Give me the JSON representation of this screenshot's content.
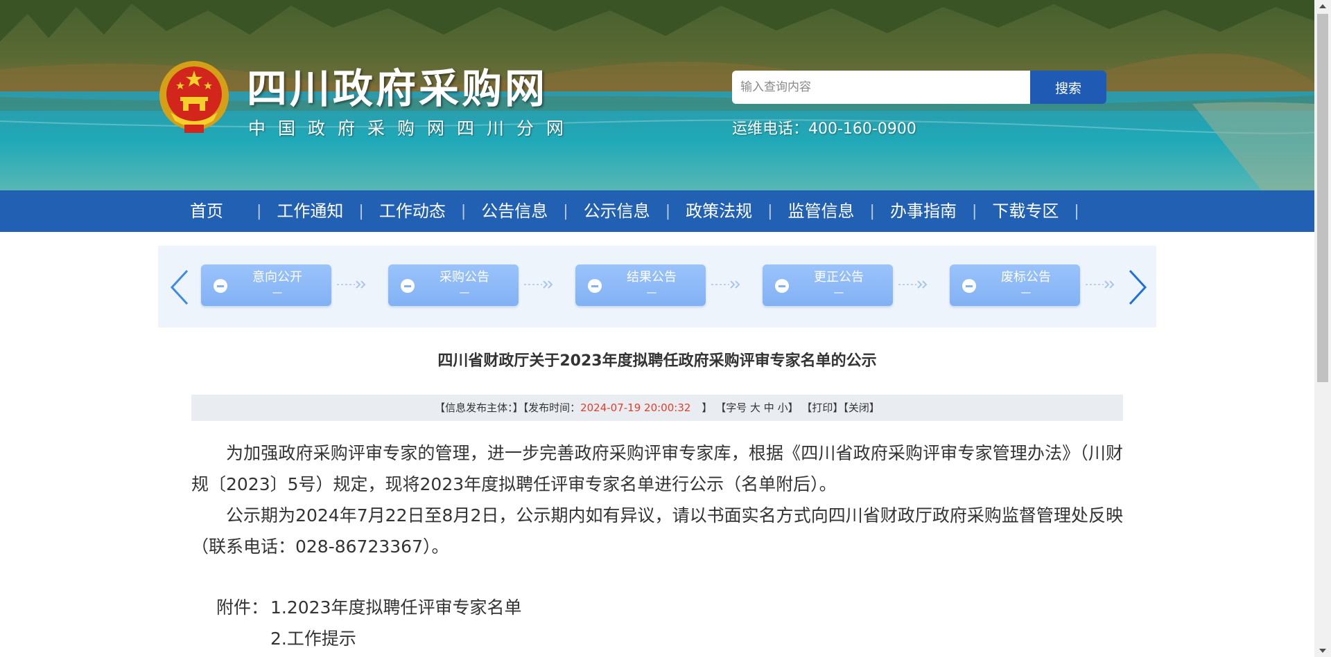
{
  "header": {
    "site_title": "四川政府采购网",
    "site_subtitle": "中国政府采购网四川分网",
    "search_placeholder": "输入查询内容",
    "search_button": "搜索",
    "hotline": "运维电话：400-160-0900"
  },
  "nav": {
    "items": [
      {
        "label": "首页"
      },
      {
        "label": "工作通知"
      },
      {
        "label": "工作动态"
      },
      {
        "label": "公告信息"
      },
      {
        "label": "公示信息"
      },
      {
        "label": "政策法规"
      },
      {
        "label": "监管信息"
      },
      {
        "label": "办事指南"
      },
      {
        "label": "下载专区"
      }
    ],
    "separator": "|"
  },
  "process": {
    "prev_icon": "chevron-left-icon",
    "next_icon": "chevron-right-icon",
    "steps": [
      {
        "label": "意向公开",
        "count": "—"
      },
      {
        "label": "采购公告",
        "count": "—"
      },
      {
        "label": "结果公告",
        "count": "—"
      },
      {
        "label": "更正公告",
        "count": "—"
      },
      {
        "label": "废标公告",
        "count": "—"
      }
    ]
  },
  "article": {
    "title": "四川省财政厅关于2023年度拟聘任政府采购评审专家名单的公示",
    "meta": {
      "publisher": "【信息发布主体：】",
      "time_label": "【发布时间：",
      "time_value": "2024-07-19 20:00:32",
      "time_close": "】",
      "font_label": "【字号",
      "font_large": "大",
      "font_medium": "中",
      "font_small": "小",
      "font_close": "】",
      "print": "【打印】",
      "close": "【关闭】"
    },
    "paragraphs": [
      "为加强政府采购评审专家的管理，进一步完善政府采购评审专家库，根据《四川省政府采购评审专家管理办法》（川财规〔2023〕5号）规定，现将2023年度拟聘任评审专家名单进行公示（名单附后）。",
      "公示期为2024年7月22日至8月2日，公示期内如有异议，请以书面实名方式向四川省财政厅政府采购监督管理处反映（联系电话：028-86723367）。"
    ],
    "attachment_label": "附件：",
    "attachments": [
      "1.2023年度拟聘任评审专家名单",
      "2.工作提示"
    ]
  },
  "colors": {
    "nav_bg": "#2260b4",
    "search_button_bg": "#1f5bb5",
    "step_bg": "#82b1f4",
    "process_bg": "#eef4fc",
    "meta_bg": "#e9edf1",
    "date_red": "#e23c2c"
  }
}
